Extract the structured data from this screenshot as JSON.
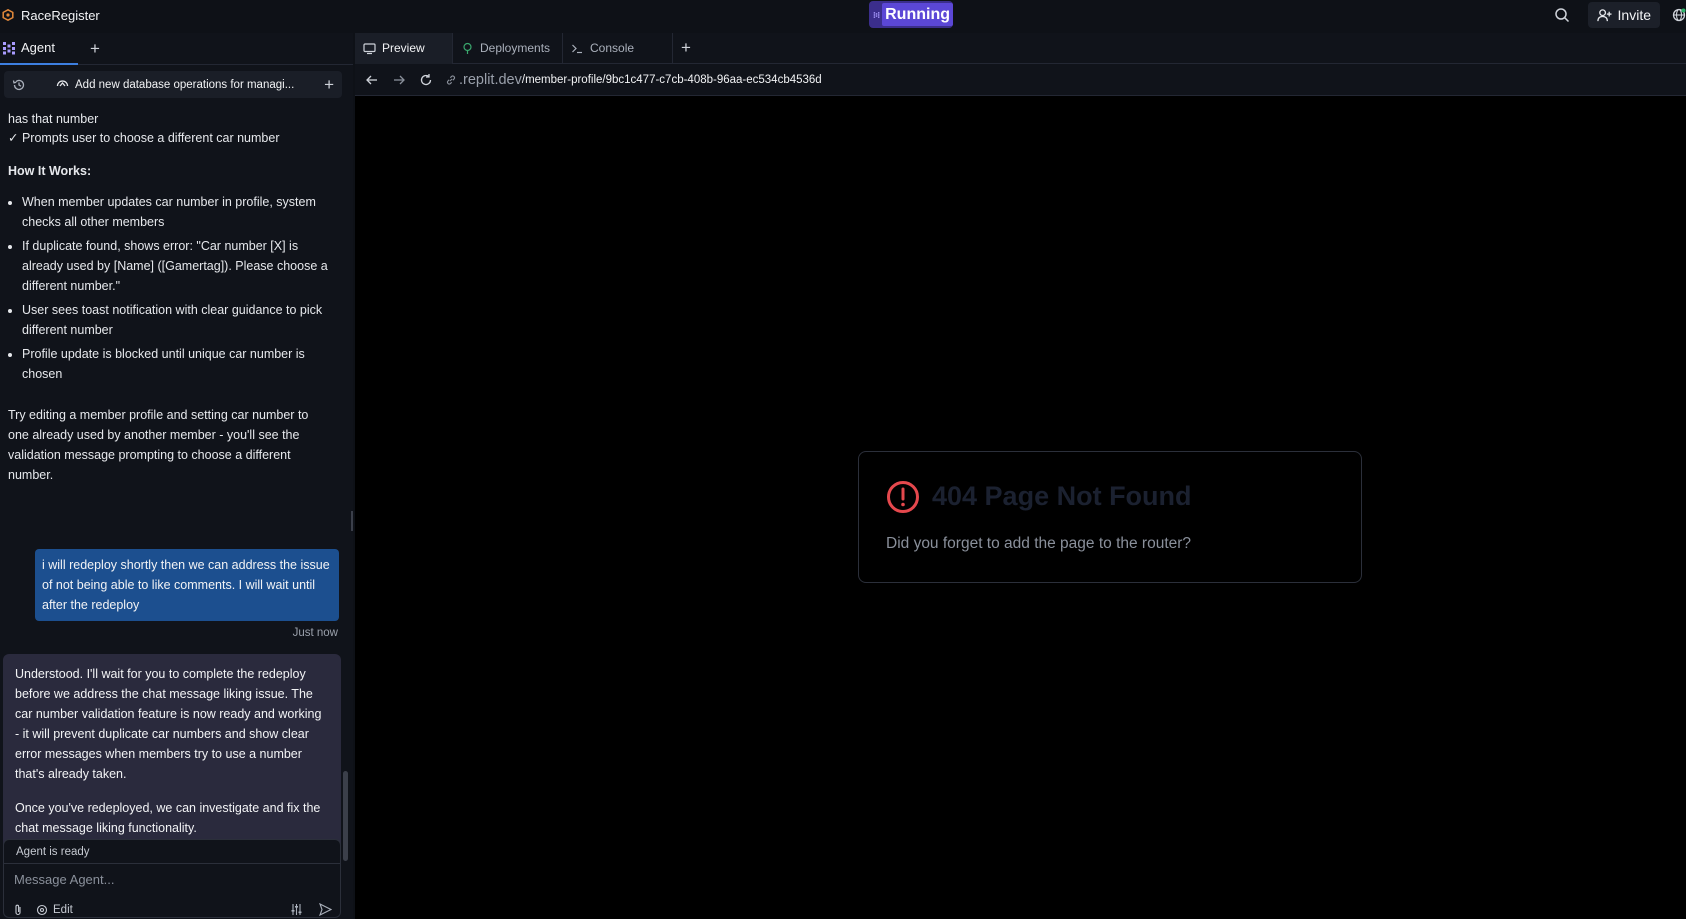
{
  "app": {
    "title": "RaceRegister"
  },
  "header": {
    "run_label": "Running",
    "invite_label": "Invite"
  },
  "agent_panel": {
    "tab_label": "Agent",
    "task_title": "Add new database operations for managi...",
    "chat": {
      "fragment_1": "has that number",
      "fragment_2": "✓ Prompts user to choose a different car number",
      "how_it_works": "How It Works:",
      "bullets": [
        "When member updates car number in profile, system checks all other members",
        "If duplicate found, shows error: \"Car number [X] is already used by [Name] ([Gamertag]). Please choose a different number.\"",
        "User sees toast notification with clear guidance to pick different number",
        "Profile update is blocked until unique car number is chosen"
      ],
      "try_para": "Try editing a member profile and setting car number to one already used by another member - you'll see the validation message prompting to choose a different number.",
      "user_message": "i will redeploy shortly then we can address the issue of not being able to like comments. I will wait until after the redeploy",
      "timestamp": "Just now",
      "agent_reply_1": "Understood. I'll wait for you to complete the redeploy before we address the chat message liking issue. The car number validation feature is now ready and working - it will prevent duplicate car numbers and show clear error messages when members try to use a number that's already taken.",
      "agent_reply_2": "Once you've redeployed, we can investigate and fix the chat message liking functionality."
    },
    "composer": {
      "status": "Agent is ready",
      "placeholder": "Message Agent...",
      "edit_label": "Edit"
    }
  },
  "workspace": {
    "tabs": [
      {
        "label": "Preview",
        "icon": "monitor-icon"
      },
      {
        "label": "Deployments",
        "icon": "deploy-icon"
      },
      {
        "label": "Console",
        "icon": "terminal-icon"
      }
    ],
    "url": {
      "domain": ".replit.dev",
      "path": "/member-profile/9bc1c477-c7cb-408b-96aa-ec534cb4536d"
    },
    "preview": {
      "error_title": "404 Page Not Found",
      "error_subtitle": "Did you forget to add the page to the router?"
    }
  },
  "colors": {
    "accent": "#5b47d6",
    "user_bubble": "#1c4f8f",
    "agent_bubble": "#2a2a3d",
    "error": "#e5484d"
  }
}
